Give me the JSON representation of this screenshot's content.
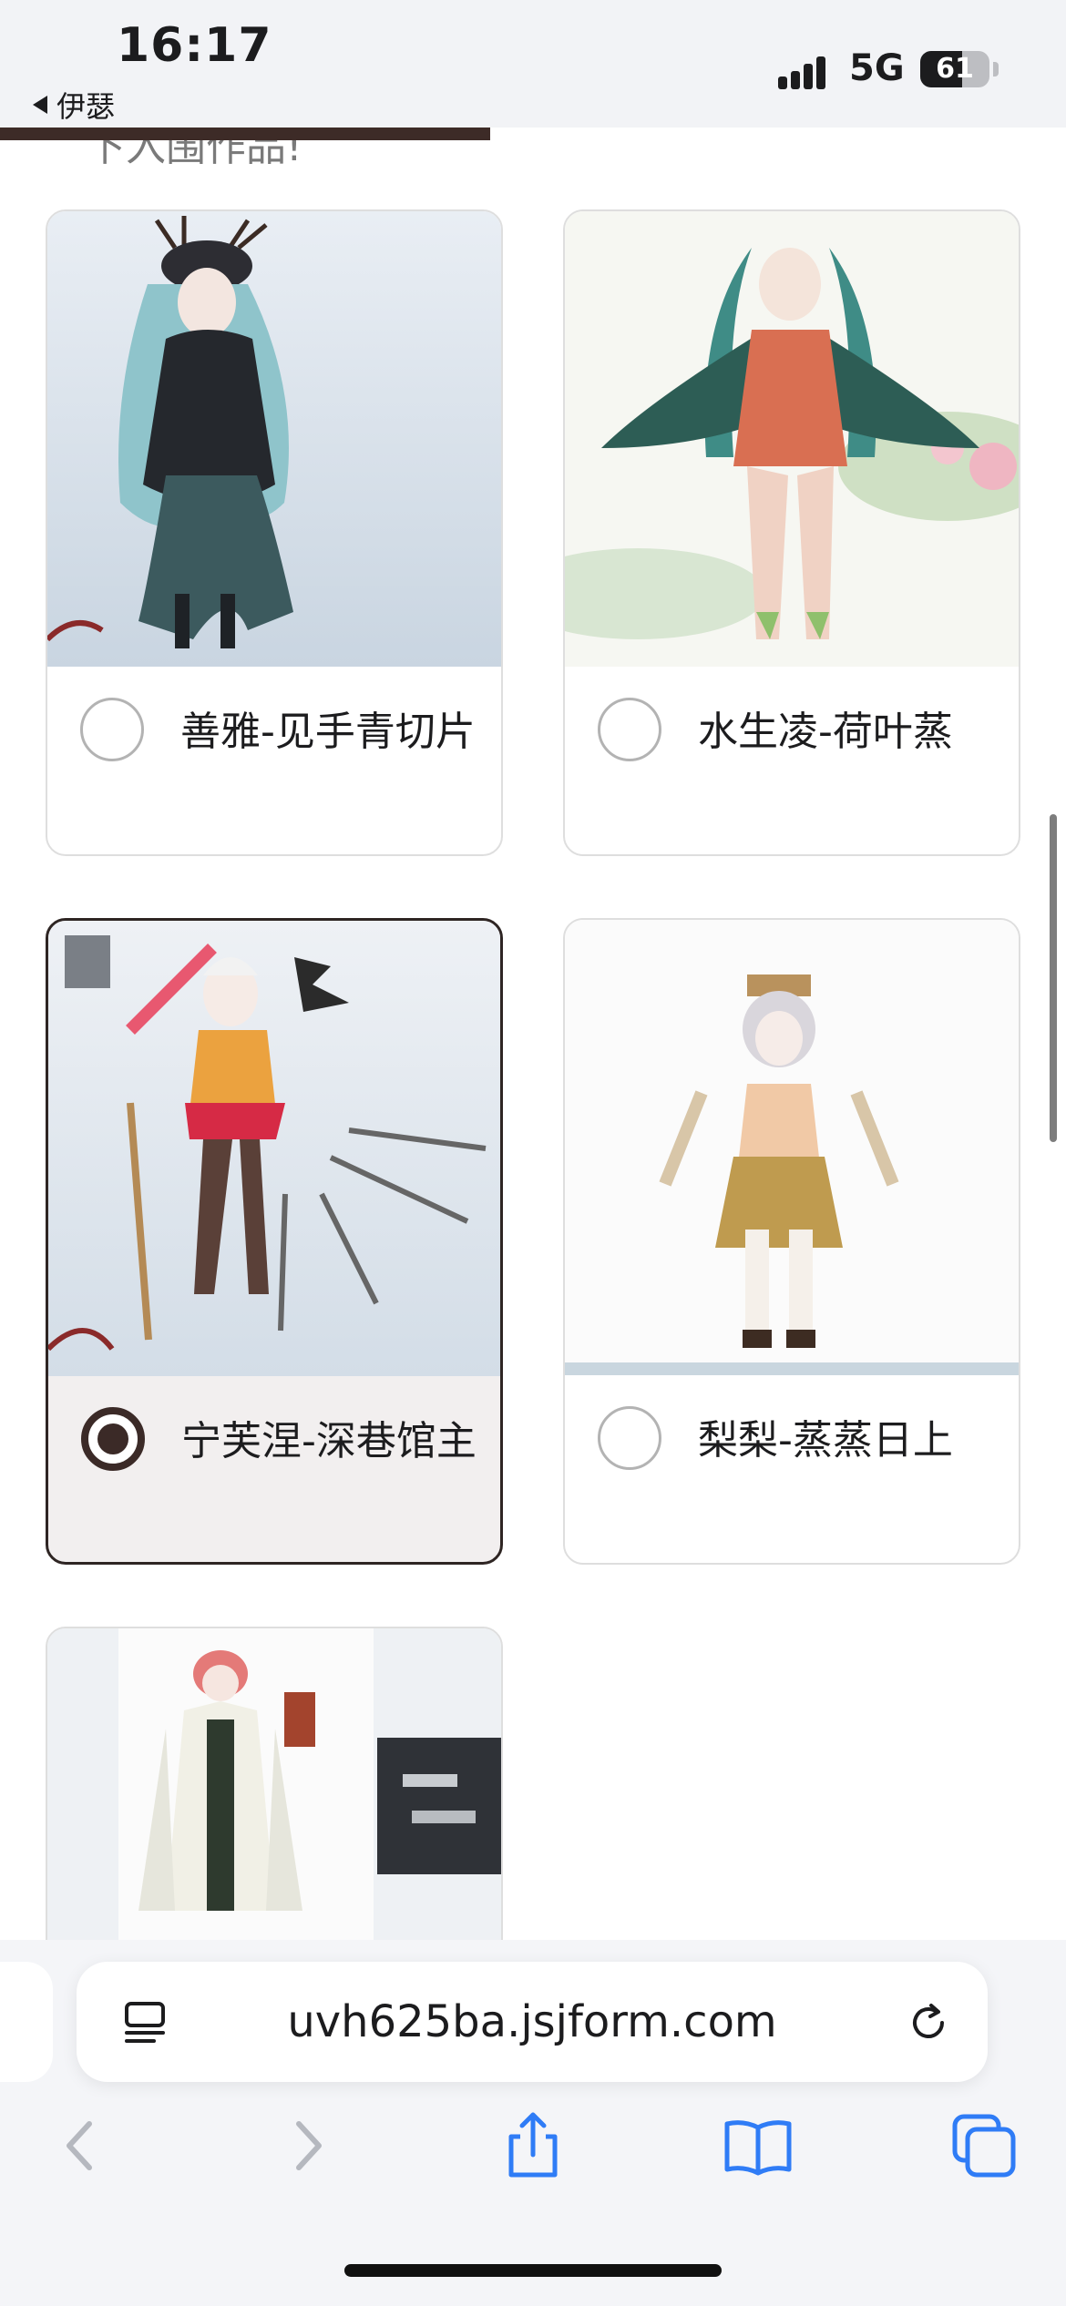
{
  "status_bar": {
    "time": "16:17",
    "back_label": "伊瑟",
    "network": "5G",
    "battery": "61",
    "battery_level": 0.61
  },
  "page_progress": 0.46,
  "section": {
    "partial_title": "下入围作品!"
  },
  "options": [
    {
      "label": "善雅-见手青切片",
      "selected": false
    },
    {
      "label": "水生凌-荷叶蒸",
      "selected": false
    },
    {
      "label": "宁芙涅-深巷馆主",
      "selected": true
    },
    {
      "label": "梨梨-蒸蒸日上",
      "selected": false
    }
  ],
  "browser": {
    "url": "uvh625ba.jsjform.com"
  },
  "icons": {
    "reader": "reader-mode-icon",
    "reload": "reload-icon",
    "back": "back-arrow-icon",
    "forward": "forward-arrow-icon",
    "share": "share-icon",
    "bookmarks": "bookmarks-icon",
    "tabs": "tabs-icon"
  },
  "colors": {
    "accent": "#3b2a27",
    "browser_blue": "#2f7cf6"
  }
}
